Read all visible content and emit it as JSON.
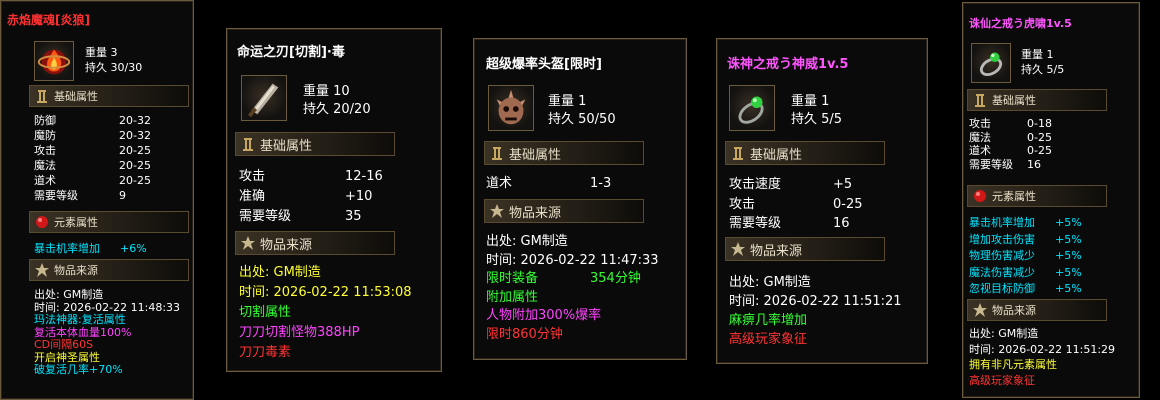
{
  "colors": {
    "white": "#ffffff",
    "cyan": "#00e5ff",
    "green": "#33ff33",
    "magenta": "#ff44ff",
    "red": "#ff3333",
    "yellow": "#ffff33",
    "title_red": "#ff3030",
    "title_magenta": "#ff55ff"
  },
  "p1": {
    "title": "赤焰魔魂[炎狼]",
    "weight": "重量 3",
    "durability": "持久 30/30",
    "sec_base": "基础属性",
    "attrs": [
      [
        "防御",
        "20-32"
      ],
      [
        "魔防",
        "20-32"
      ],
      [
        "攻击",
        "20-25"
      ],
      [
        "魔法",
        "20-25"
      ],
      [
        "道术",
        "20-25"
      ],
      [
        "需要等级",
        "9"
      ]
    ],
    "sec_elem": "元素属性",
    "elem": [
      [
        "暴击机率增加",
        "+6%"
      ]
    ],
    "sec_src": "物品来源",
    "src_line1": "出处: GM制造",
    "src_line2": "时间: 2026-02-22 11:48:33",
    "extras": [
      "玛法神器:复活属性",
      "复活本体血量100%",
      "CD间隔60S",
      "开启神圣属性",
      "破复活几率+70%"
    ]
  },
  "p2": {
    "title": "命运之刃[切割]·毒",
    "weight": "重量 10",
    "durability": "持久 20/20",
    "sec_base": "基础属性",
    "attrs": [
      [
        "攻击",
        "12-16"
      ],
      [
        "准确",
        "+10"
      ],
      [
        "需要等级",
        "35"
      ]
    ],
    "sec_src": "物品来源",
    "src_line1": "出处: GM制造",
    "src_line2": "时间: 2026-02-22 11:53:08",
    "extras": [
      "切割属性",
      "刀刀切割怪物388HP",
      "刀刀毒素"
    ]
  },
  "p3": {
    "title": "超级爆率头盔[限时]",
    "weight": "重量 1",
    "durability": "持久 50/50",
    "sec_base": "基础属性",
    "attrs": [
      [
        "道术",
        "1-3"
      ]
    ],
    "sec_src": "物品来源",
    "src_line1": "出处: GM制造",
    "src_line2": "时间: 2026-02-22 11:47:33",
    "limited_label": "限时装备",
    "limited_value": "354分钟",
    "extras": [
      "附加属性",
      "人物附加300%爆率",
      "限时860分钟"
    ]
  },
  "p4": {
    "title": "诛神之戒う神威1v.5",
    "weight": "重量 1",
    "durability": "持久 5/5",
    "sec_base": "基础属性",
    "attrs": [
      [
        "攻击速度",
        "+5"
      ],
      [
        "攻击",
        "0-25"
      ],
      [
        "需要等级",
        "16"
      ]
    ],
    "sec_src": "物品来源",
    "src_line1": "出处: GM制造",
    "src_line2": "时间: 2026-02-22 11:51:21",
    "extras": [
      "麻痹几率增加",
      "高级玩家象征"
    ]
  },
  "p5": {
    "title": "诛仙之戒う虎啸1v.5",
    "weight": "重量 1",
    "durability": "持久 5/5",
    "sec_base": "基础属性",
    "attrs": [
      [
        "攻击",
        "0-18"
      ],
      [
        "魔法",
        "0-25"
      ],
      [
        "道术",
        "0-25"
      ],
      [
        "需要等级",
        "16"
      ]
    ],
    "sec_elem": "元素属性",
    "elem": [
      [
        "暴击机率增加",
        "+5%"
      ],
      [
        "增加攻击伤害",
        "+5%"
      ],
      [
        "物理伤害减少",
        "+5%"
      ],
      [
        "魔法伤害减少",
        "+5%"
      ],
      [
        "忽视目标防御",
        "+5%"
      ]
    ],
    "sec_src": "物品来源",
    "src_line1": "出处: GM制造",
    "src_line2": "时间: 2026-02-22 11:51:29",
    "extras": [
      "拥有非凡元素属性",
      "高级玩家象征"
    ]
  }
}
